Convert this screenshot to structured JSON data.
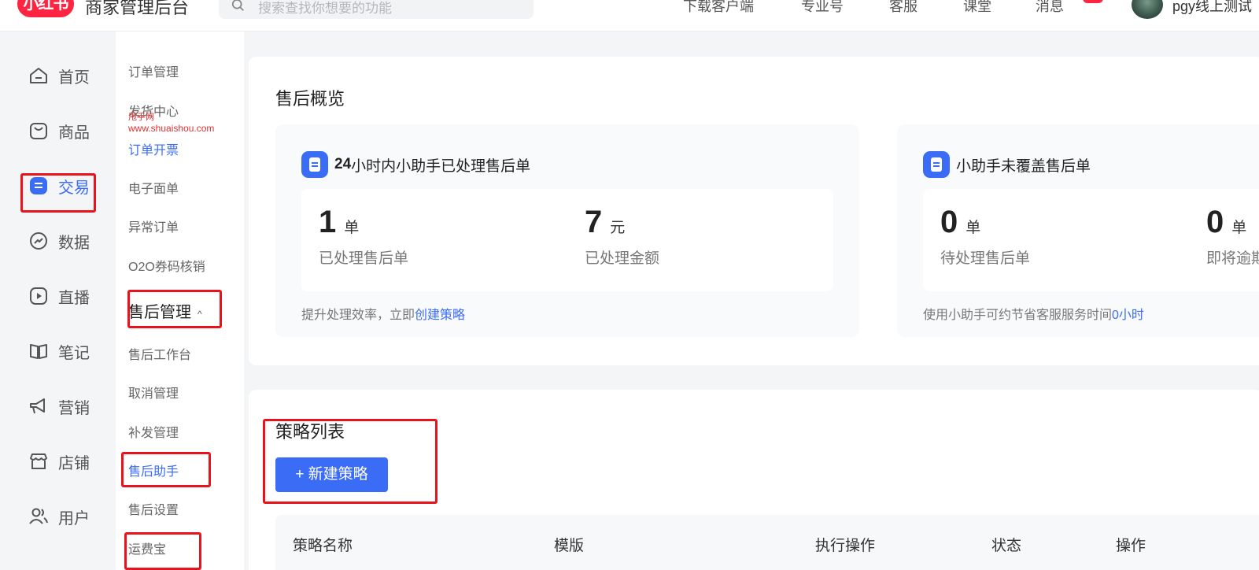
{
  "topbar": {
    "logo": "小红书",
    "app_title": "商家管理后台",
    "search_placeholder": "搜索查找你想要的功能",
    "links": [
      "下载客户端",
      "专业号",
      "客服",
      "课堂",
      "消息"
    ],
    "username": "pgy线上测试"
  },
  "rail": {
    "items": [
      {
        "label": "首页",
        "icon": "home-icon"
      },
      {
        "label": "商品",
        "icon": "product-bag-icon"
      },
      {
        "label": "交易",
        "icon": "trade-doc-icon",
        "active": true
      },
      {
        "label": "数据",
        "icon": "chart-trend-icon"
      },
      {
        "label": "直播",
        "icon": "play-icon"
      },
      {
        "label": "笔记",
        "icon": "book-icon"
      },
      {
        "label": "营销",
        "icon": "megaphone-icon"
      },
      {
        "label": "店铺",
        "icon": "store-icon"
      },
      {
        "label": "用户",
        "icon": "users-icon"
      }
    ]
  },
  "subnav": {
    "items_top": [
      "订单管理",
      "发货中心",
      "订单开票",
      "电子面单",
      "异常订单",
      "O2O券码核销"
    ],
    "watermark_line1": "甩手网",
    "watermark_line2": "www.shuaishou.com",
    "group_label": "售后管理",
    "group_caret": "^",
    "items_group": [
      "售后工作台",
      "取消管理",
      "补发管理",
      "售后助手",
      "售后设置",
      "运费宝"
    ]
  },
  "overview": {
    "title": "售后概览",
    "card1": {
      "head_strong": "24",
      "head_rest": "小时内小助手已处理售后单",
      "stats": [
        {
          "value": "1",
          "unit": "单",
          "label": "已处理售后单"
        },
        {
          "value": "7",
          "unit": "元",
          "label": "已处理金额"
        }
      ],
      "foot_text": "提升处理效率，立即",
      "foot_link": "创建策略"
    },
    "card2": {
      "head": "小助手未覆盖售后单",
      "stats": [
        {
          "value": "0",
          "unit": "单",
          "label": "待处理售后单"
        },
        {
          "value": "0",
          "unit": "单",
          "label": "即将逾期"
        }
      ],
      "foot_text": "使用小助手可约节省客服服务时间",
      "foot_link": "0小时"
    }
  },
  "strategy": {
    "title": "策略列表",
    "new_button": "+ 新建策略",
    "columns": [
      "策略名称",
      "模版",
      "执行操作",
      "状态",
      "操作"
    ]
  },
  "colors": {
    "accent": "#3b6cf6",
    "brand": "#ff2442",
    "annotation": "#e8131b"
  }
}
